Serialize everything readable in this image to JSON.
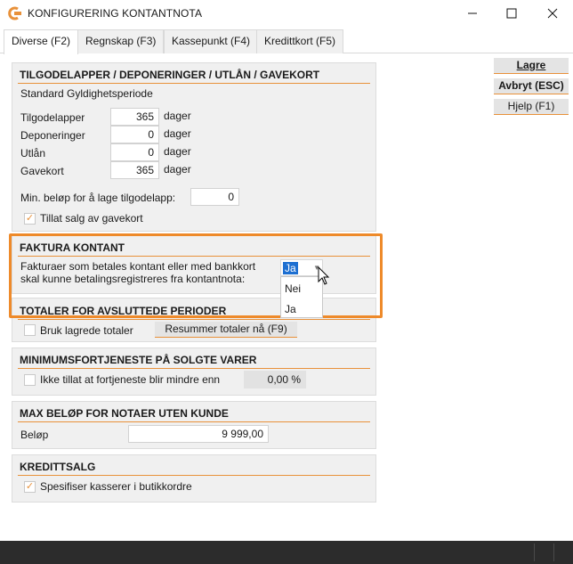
{
  "window": {
    "title": "KONFIGURERING KONTANTNOTA"
  },
  "tabs": [
    {
      "label": "Diverse (F2)"
    },
    {
      "label": "Regnskap (F3)"
    },
    {
      "label": "Kassepunkt (F4)"
    },
    {
      "label": "Kredittkort (F5)"
    }
  ],
  "buttons": {
    "save": "Lagre",
    "cancel": "Avbryt (ESC)",
    "help": "Hjelp (F1)"
  },
  "sections": {
    "tilgodelapper": {
      "title": "TILGODELAPPER / DEPONERINGER / UTLÅN / GAVEKORT",
      "subtitle": "Standard Gyldighetsperiode",
      "rows": [
        {
          "label": "Tilgodelapper",
          "value": "365",
          "unit": "dager"
        },
        {
          "label": "Deponeringer",
          "value": "0",
          "unit": "dager"
        },
        {
          "label": "Utlån",
          "value": "0",
          "unit": "dager"
        },
        {
          "label": "Gavekort",
          "value": "365",
          "unit": "dager"
        }
      ],
      "min_amount_label": "Min. beløp for å lage tilgodelapp:",
      "min_amount_value": "0",
      "allow_gift_label": "Tillat salg av gavekort",
      "allow_gift_checked": true
    },
    "faktura": {
      "title": "FAKTURA KONTANT",
      "text_line1": "Fakturaer som betales kontant eller med bankkort",
      "text_line2": "skal kunne betalingsregistreres fra kontantnota:",
      "selected": "Ja",
      "options": [
        "Nei",
        "Ja"
      ]
    },
    "totaler": {
      "title": "TOTALER FOR AVSLUTTEDE PERIODER",
      "checkbox_label": "Bruk lagrede totaler",
      "checked": false,
      "button": "Resummer totaler nå (F9)"
    },
    "minfortjeneste": {
      "title": "MINIMUMSFORTJENESTE PÅ SOLGTE VARER",
      "checkbox_label": "Ikke tillat at fortjeneste blir mindre enn",
      "checked": false,
      "value": "0,00 %"
    },
    "maxbelop": {
      "title": "MAX BELØP FOR NOTAER UTEN KUNDE",
      "label": "Beløp",
      "value": "9 999,00"
    },
    "kredittsalg": {
      "title": "KREDITTSALG",
      "checkbox_label": "Spesifiser kasserer i butikkordre",
      "checked": true
    }
  },
  "colors": {
    "accent": "#e8913a",
    "highlight": "#ee8a2a",
    "selection": "#1d6fd1"
  },
  "icons": {
    "app": "app-logo-icon",
    "minimize": "minimize-icon",
    "maximize": "maximize-icon",
    "close": "close-icon",
    "check": "checkmark-icon",
    "dropdown": "chevron-down-icon",
    "cursor": "mouse-pointer-icon"
  }
}
